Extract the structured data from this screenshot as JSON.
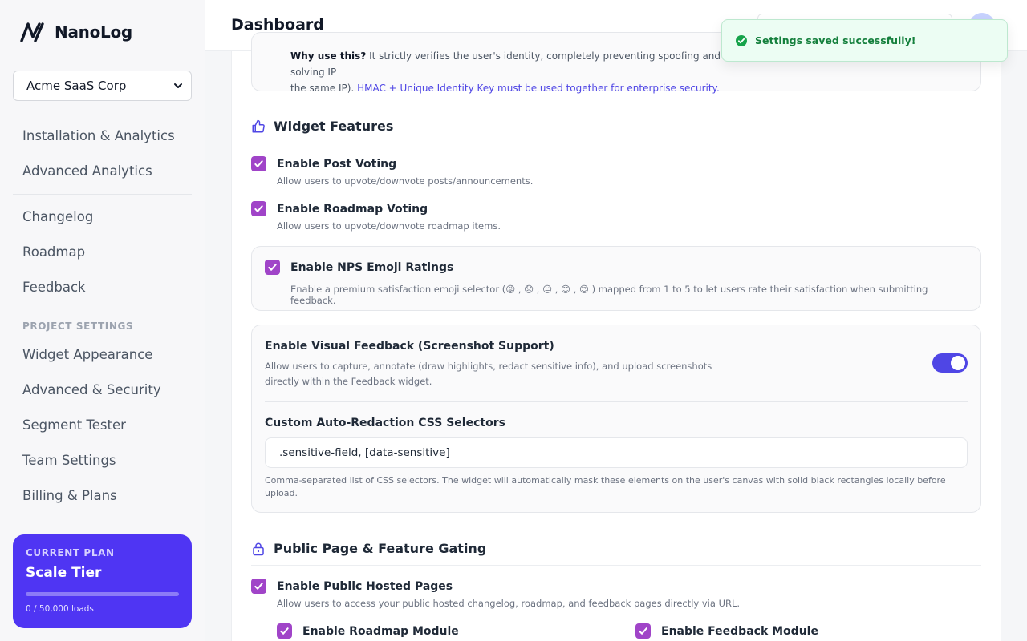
{
  "app": {
    "name": "NanoLog"
  },
  "sidebar": {
    "org": "Acme SaaS Corp",
    "group1": [
      "Installation & Analytics",
      "Advanced Analytics"
    ],
    "group2": [
      "Changelog",
      "Roadmap",
      "Feedback"
    ],
    "section_label": "PROJECT SETTINGS",
    "group3": [
      "Widget Appearance",
      "Advanced & Security",
      "Segment Tester",
      "Team Settings",
      "Billing & Plans"
    ],
    "plan": {
      "kicker": "CURRENT PLAN",
      "name": "Scale Tier",
      "usage": "0 / 50,000 loads",
      "progress": 0
    }
  },
  "header": {
    "title": "Dashboard"
  },
  "toast": {
    "message": "Settings saved successfully!"
  },
  "identity_note": {
    "bold": "Why use this?",
    "text": " It strictly verifies the user's identity, completely preventing spoofing and solving IP",
    "line2": "the same IP). ",
    "link": "HMAC + Unique Identity Key must be used together for enterprise security."
  },
  "widget_features": {
    "title": "Widget Features",
    "post_voting": {
      "label": "Enable Post Voting",
      "desc": "Allow users to upvote/downvote posts/announcements."
    },
    "roadmap_voting": {
      "label": "Enable Roadmap Voting",
      "desc": "Allow users to upvote/downvote roadmap items."
    },
    "nps": {
      "label": "Enable NPS Emoji Ratings",
      "desc": "Enable a premium satisfaction emoji selector (😡 , 😞 , 😐 , 😊 , 😍 ) mapped from 1 to 5 to let users rate their satisfaction when submitting feedback."
    },
    "visual": {
      "label": "Enable Visual Feedback (Screenshot Support)",
      "desc_line1": "Allow users to capture, annotate (draw highlights, redact sensitive info), and upload screenshots",
      "desc_line2": "directly within the Feedback widget.",
      "selectors_label": "Custom Auto-Redaction CSS Selectors",
      "selectors_value": ".sensitive-field, [data-sensitive]",
      "selectors_help": "Comma-separated list of CSS selectors. The widget will automatically mask these elements on the user's canvas with solid black rectangles locally before upload."
    }
  },
  "public_page": {
    "title": "Public Page & Feature Gating",
    "hosted": {
      "label": "Enable Public Hosted Pages",
      "desc": "Allow users to access your public hosted changelog, roadmap, and feedback pages directly via URL."
    },
    "roadmap_module": "Enable Roadmap Module",
    "feedback_module": "Enable Feedback Module"
  },
  "colors": {
    "accent": "#4f46e5",
    "checkbox": "#a044c8",
    "plan_card": "#4f35f3",
    "toast_bg": "#ecfdf3"
  }
}
